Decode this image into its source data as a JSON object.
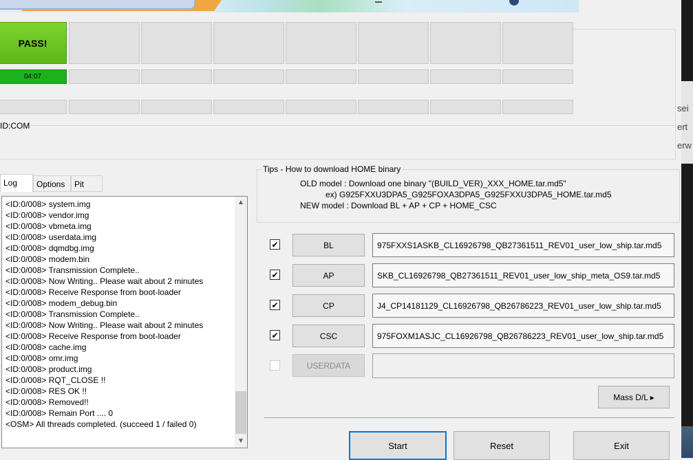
{
  "status": {
    "pass_label": "PASS!",
    "timer": "04:07",
    "port_id": "ID:COM"
  },
  "tabs": [
    {
      "label": "Log"
    },
    {
      "label": "Options"
    },
    {
      "label": "Pit"
    }
  ],
  "log": {
    "lines": [
      "<ID:0/008> system.img",
      "<ID:0/008> vendor.img",
      "<ID:0/008> vbmeta.img",
      "<ID:0/008> userdata.img",
      "<ID:0/008> dqmdbg.img",
      "<ID:0/008> modem.bin",
      "<ID:0/008> Transmission Complete..",
      "<ID:0/008> Now Writing.. Please wait about 2 minutes",
      "<ID:0/008> Receive Response from boot-loader",
      "<ID:0/008> modem_debug.bin",
      "<ID:0/008> Transmission Complete..",
      "<ID:0/008> Now Writing.. Please wait about 2 minutes",
      "<ID:0/008> Receive Response from boot-loader",
      "<ID:0/008> cache.img",
      "<ID:0/008> omr.img",
      "<ID:0/008> product.img",
      "<ID:0/008> RQT_CLOSE !!",
      "<ID:0/008> RES OK !!",
      "<ID:0/008> Removed!!",
      "<ID:0/008> Remain Port ....  0",
      "<OSM> All threads completed. (succeed 1 / failed 0)"
    ]
  },
  "tips": {
    "title": "Tips - How to download HOME binary",
    "line1": "OLD model  : Download one binary    \"(BUILD_VER)_XXX_HOME.tar.md5\"",
    "line2": "ex) G925FXXU3DPA5_G925FOXA3DPA5_G925FXXU3DPA5_HOME.tar.md5",
    "line3": "NEW model : Download BL + AP + CP + HOME_CSC"
  },
  "files": [
    {
      "button": "BL",
      "checked": true,
      "path": "975FXXS1ASKB_CL16926798_QB27361511_REV01_user_low_ship.tar.md5"
    },
    {
      "button": "AP",
      "checked": true,
      "path": "SKB_CL16926798_QB27361511_REV01_user_low_ship_meta_OS9.tar.md5"
    },
    {
      "button": "CP",
      "checked": true,
      "path": "J4_CP14181129_CL16926798_QB26786223_REV01_user_low_ship.tar.md5"
    },
    {
      "button": "CSC",
      "checked": true,
      "path": "975FOXM1ASJC_CL16926798_QB26786223_REV01_user_low_ship.tar.md5"
    },
    {
      "button": "USERDATA",
      "checked": false,
      "path": ""
    }
  ],
  "actions": {
    "mass_dl": "Mass D/L ▸",
    "start": "Start",
    "reset": "Reset",
    "exit": "Exit"
  },
  "background_window": {
    "lines": [
      "sei",
      "ert",
      "erw"
    ]
  },
  "colors": {
    "pass_green": "#6cc626",
    "progress_green": "#1db21d",
    "focus_blue": "#0078d7"
  }
}
